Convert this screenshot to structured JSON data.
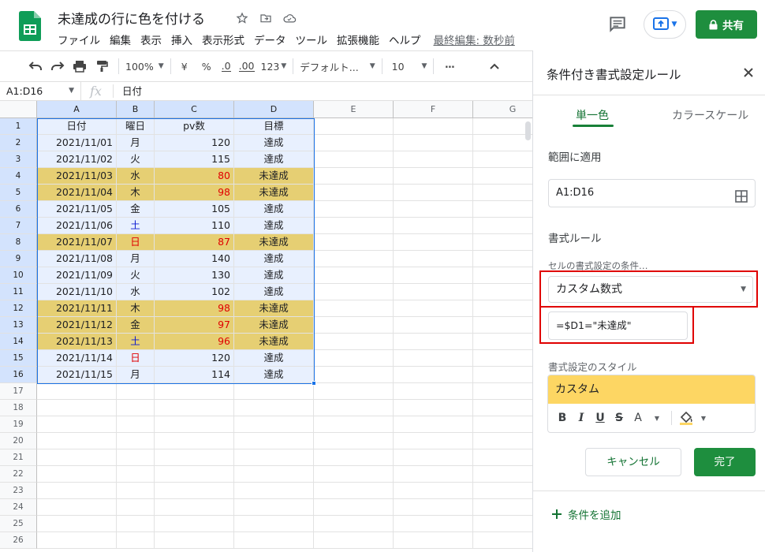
{
  "app": {
    "doc_title": "未達成の行に色を付ける",
    "menu": [
      "ファイル",
      "編集",
      "表示",
      "挿入",
      "表示形式",
      "データ",
      "ツール",
      "拡張機能",
      "ヘルプ"
    ],
    "last_edit": "最終編集: 数秒前",
    "share_label": "共有",
    "colors": {
      "green": "#1e8e3e",
      "highlight": "#e6cf73",
      "selection": "#e8f0fe",
      "rule_frame": "#e00000"
    }
  },
  "toolbar": {
    "zoom": "100%",
    "currency": "¥",
    "percent": "%",
    "dec_less": ".0",
    "dec_more": ".00",
    "format_more": "123",
    "font": "デフォルト...",
    "font_size": "10",
    "more": "⋯"
  },
  "formula_bar": {
    "name_box": "A1:D16",
    "fx": "fx",
    "value": "日付"
  },
  "sheet": {
    "columns": [
      "A",
      "B",
      "C",
      "D",
      "E",
      "F",
      "G"
    ],
    "row_numbers": [
      "1",
      "2",
      "3",
      "4",
      "5",
      "6",
      "7",
      "8",
      "9",
      "10",
      "11",
      "12",
      "13",
      "14",
      "15",
      "16",
      "17",
      "18",
      "19",
      "20",
      "21",
      "22",
      "23",
      "24",
      "25",
      "26"
    ],
    "header": [
      "日付",
      "曜日",
      "pv数",
      "目標"
    ],
    "rows": [
      [
        "2021/11/01",
        "月",
        "120",
        "達成"
      ],
      [
        "2021/11/02",
        "火",
        "115",
        "達成"
      ],
      [
        "2021/11/03",
        "水",
        "80",
        "未達成"
      ],
      [
        "2021/11/04",
        "木",
        "98",
        "未達成"
      ],
      [
        "2021/11/05",
        "金",
        "105",
        "達成"
      ],
      [
        "2021/11/06",
        "土",
        "110",
        "達成"
      ],
      [
        "2021/11/07",
        "日",
        "87",
        "未達成"
      ],
      [
        "2021/11/08",
        "月",
        "140",
        "達成"
      ],
      [
        "2021/11/09",
        "火",
        "130",
        "達成"
      ],
      [
        "2021/11/10",
        "水",
        "102",
        "達成"
      ],
      [
        "2021/11/11",
        "木",
        "98",
        "未達成"
      ],
      [
        "2021/11/12",
        "金",
        "97",
        "未達成"
      ],
      [
        "2021/11/13",
        "土",
        "96",
        "未達成"
      ],
      [
        "2021/11/14",
        "日",
        "120",
        "達成"
      ],
      [
        "2021/11/15",
        "月",
        "114",
        "達成"
      ]
    ]
  },
  "panel": {
    "title": "条件付き書式設定ルール",
    "tab_single": "単一色",
    "tab_scale": "カラースケール",
    "range_label": "範囲に適用",
    "range_value": "A1:D16",
    "rules_label": "書式ルール",
    "condition_label": "セルの書式設定の条件…",
    "condition_value": "カスタム数式",
    "formula_value": "=$D1=\"未達成\"",
    "style_label": "書式設定のスタイル",
    "style_preview": "カスタム",
    "style_tools": {
      "bold": "B",
      "italic": "I",
      "underline": "U",
      "strike": "S",
      "text_color": "A"
    },
    "cancel_label": "キャンセル",
    "done_label": "完了",
    "add_rule_label": "条件を追加"
  }
}
